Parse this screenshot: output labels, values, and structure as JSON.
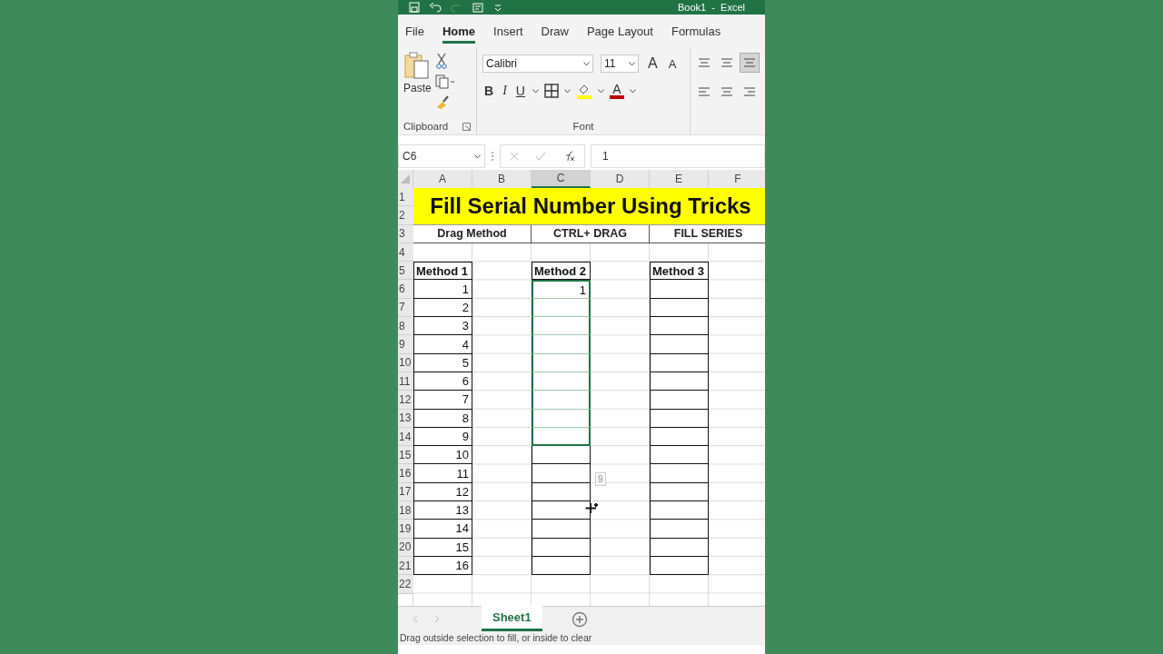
{
  "title_bar": {
    "title": "Book1  -  Excel"
  },
  "ribbon_tabs": [
    {
      "label": "File",
      "selected": false
    },
    {
      "label": "Home",
      "selected": true
    },
    {
      "label": "Insert",
      "selected": false
    },
    {
      "label": "Draw",
      "selected": false
    },
    {
      "label": "Page Layout",
      "selected": false
    },
    {
      "label": "Formulas",
      "selected": false
    }
  ],
  "clipboard": {
    "paste_label": "Paste",
    "group_label": "Clipboard"
  },
  "font": {
    "font_name": "Calibri",
    "font_size": "11",
    "grow": "A",
    "shrink": "A",
    "bold": "B",
    "italic": "I",
    "underline": "U",
    "font_color": "A",
    "group_label": "Font"
  },
  "formula_bar": {
    "name_box": "C6",
    "value": "1"
  },
  "columns": [
    {
      "label": "A",
      "selected": false
    },
    {
      "label": "B",
      "selected": false
    },
    {
      "label": "C",
      "selected": true
    },
    {
      "label": "D",
      "selected": false
    },
    {
      "label": "E",
      "selected": false
    },
    {
      "label": "F",
      "selected": false
    }
  ],
  "row_numbers": [
    "1",
    "2",
    "3",
    "4",
    "5",
    "6",
    "7",
    "8",
    "9",
    "10",
    "11",
    "12",
    "13",
    "14",
    "15",
    "16",
    "17",
    "18",
    "19",
    "20",
    "21",
    "22"
  ],
  "sheet_title": "Fill Serial Number Using Tricks",
  "section_headers": [
    "Drag Method",
    "CTRL+ DRAG",
    "FILL SERIES"
  ],
  "tables": [
    {
      "heading": "Method 1",
      "cells": [
        {
          "value": "1",
          "selected": false
        },
        {
          "value": "2",
          "selected": false
        },
        {
          "value": "3",
          "selected": false
        },
        {
          "value": "4",
          "selected": false
        },
        {
          "value": "5",
          "selected": false
        },
        {
          "value": "6",
          "selected": false
        },
        {
          "value": "7",
          "selected": false
        },
        {
          "value": "8",
          "selected": false
        },
        {
          "value": "9",
          "selected": false
        },
        {
          "value": "10",
          "selected": false
        },
        {
          "value": "11",
          "selected": false
        },
        {
          "value": "12",
          "selected": false
        },
        {
          "value": "13",
          "selected": false
        },
        {
          "value": "14",
          "selected": false
        },
        {
          "value": "15",
          "selected": false
        },
        {
          "value": "16",
          "selected": false
        }
      ]
    },
    {
      "heading": "Method 2",
      "cells": [
        {
          "value": "1",
          "selected": true
        },
        {
          "selected": true
        },
        {
          "selected": true
        },
        {
          "selected": true
        },
        {
          "selected": true
        },
        {
          "selected": true
        },
        {
          "selected": true
        },
        {
          "selected": true
        },
        {
          "selected": true
        },
        {
          "selected": false
        },
        {
          "selected": false
        },
        {
          "selected": false
        },
        {
          "selected": false
        },
        {
          "selected": false
        },
        {
          "selected": false
        },
        {
          "selected": false
        }
      ]
    },
    {
      "heading": "Method 3",
      "cells": [
        {
          "selected": false
        },
        {
          "selected": false
        },
        {
          "selected": false
        },
        {
          "selected": false
        },
        {
          "selected": false
        },
        {
          "selected": false
        },
        {
          "selected": false
        },
        {
          "selected": false
        },
        {
          "selected": false
        },
        {
          "selected": false
        },
        {
          "selected": false
        },
        {
          "selected": false
        },
        {
          "selected": false
        },
        {
          "selected": false
        },
        {
          "selected": false
        },
        {
          "selected": false
        }
      ]
    }
  ],
  "fill_tooltip": "9",
  "sheet_tabs": [
    {
      "label": "Sheet1",
      "selected": true
    }
  ],
  "status_bar": "Drag outside selection to fill, or inside to clear"
}
